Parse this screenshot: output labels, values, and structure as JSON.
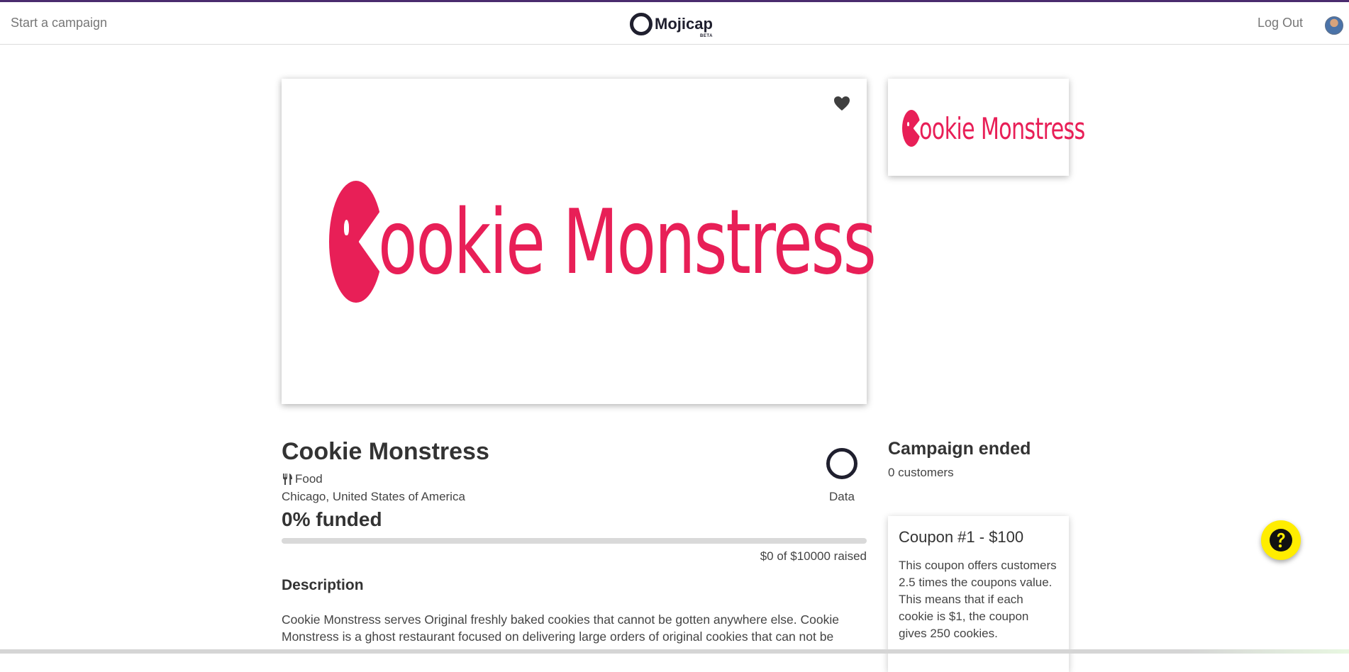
{
  "nav": {
    "start_campaign": "Start a campaign",
    "logo_text": "Mojicap",
    "logo_badge": "BETA",
    "logout": "Log Out"
  },
  "campaign": {
    "brand": "Cookie Monstress",
    "brand_logo_word": "ookie Monstress",
    "name": "Cookie Monstress",
    "category": "Food",
    "category_icon": "utensils-icon",
    "location": "Chicago, United States of America",
    "funded_text": "0% funded",
    "funded_fraction": 0,
    "raised_text": "$0 of $10000 raised",
    "data_label": "Data",
    "status": "Campaign ended",
    "customers": "0 customers",
    "description_heading": "Description",
    "description": "Cookie Monstress serves Original freshly baked cookies that cannot be gotten anywhere else. Cookie Monstress is a ghost restaurant focused on delivering large orders of original cookies that can not be"
  },
  "coupon": {
    "title": "Coupon #1 - $100",
    "description": "This coupon offers customers 2.5 times the coupons value. This means that if each cookie is $1, the coupon gives 250 cookies."
  },
  "colors": {
    "brand": "#e81f57",
    "help_button": "#ffed00",
    "accent": "#4a2b6e"
  }
}
